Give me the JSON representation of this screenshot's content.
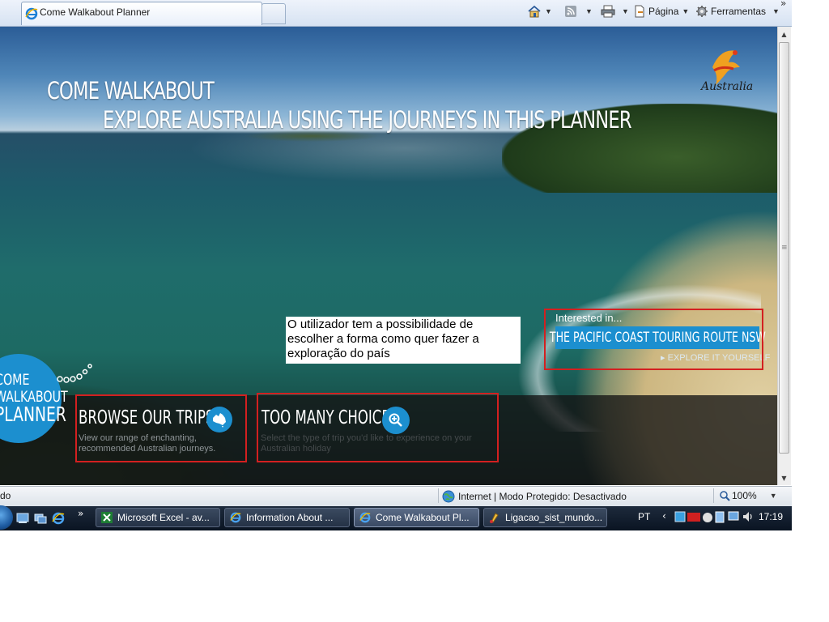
{
  "browser": {
    "tab_title": "Come Walkabout Planner",
    "page_menu": "Página",
    "tools_menu": "Ferramentas",
    "more_chevron": "»"
  },
  "page": {
    "hero_line1": "COME WALKABOUT",
    "hero_line2": "EXPLORE AUSTRALIA USING THE JOURNEYS IN THIS PLANNER",
    "logo_text": "Australia",
    "interested_label": "Interested in...",
    "pacific_button": "THE PACIFIC COAST TOURING ROUTE NSW",
    "explore_link": "EXPLORE IT YOURSELF",
    "planner_badge": [
      "COME",
      "WALKABOUT",
      "PLANNER"
    ],
    "browse_title": "BROWSE OUR TRIPS",
    "browse_desc": "View our range of enchanting, recommended Australian journeys.",
    "choices_title": "TOO MANY CHOICES?",
    "choices_desc": "Select the type of trip you'd like to experience on your Australian holiday"
  },
  "annotation": {
    "text": "O utilizador tem a possibilidade de escolher a forma como quer fazer a exploração do país"
  },
  "statusbar": {
    "left_text": "do",
    "zone": "Internet | Modo Protegido: Desactivado",
    "zoom": "100%"
  },
  "taskbar": {
    "items": [
      {
        "label": "Microsoft Excel - av...",
        "icon": "excel-icon"
      },
      {
        "label": "Information About ...",
        "icon": "ie-icon"
      },
      {
        "label": "Come Walkabout Pl...",
        "icon": "ie-icon"
      },
      {
        "label": "Ligacao_sist_mundo...",
        "icon": "paint-icon"
      }
    ],
    "quicklaunch_more": "»",
    "language": "PT",
    "time": "17:19"
  },
  "colors": {
    "accent_blue": "#1c8fcf",
    "highlight_red": "#d32020"
  }
}
